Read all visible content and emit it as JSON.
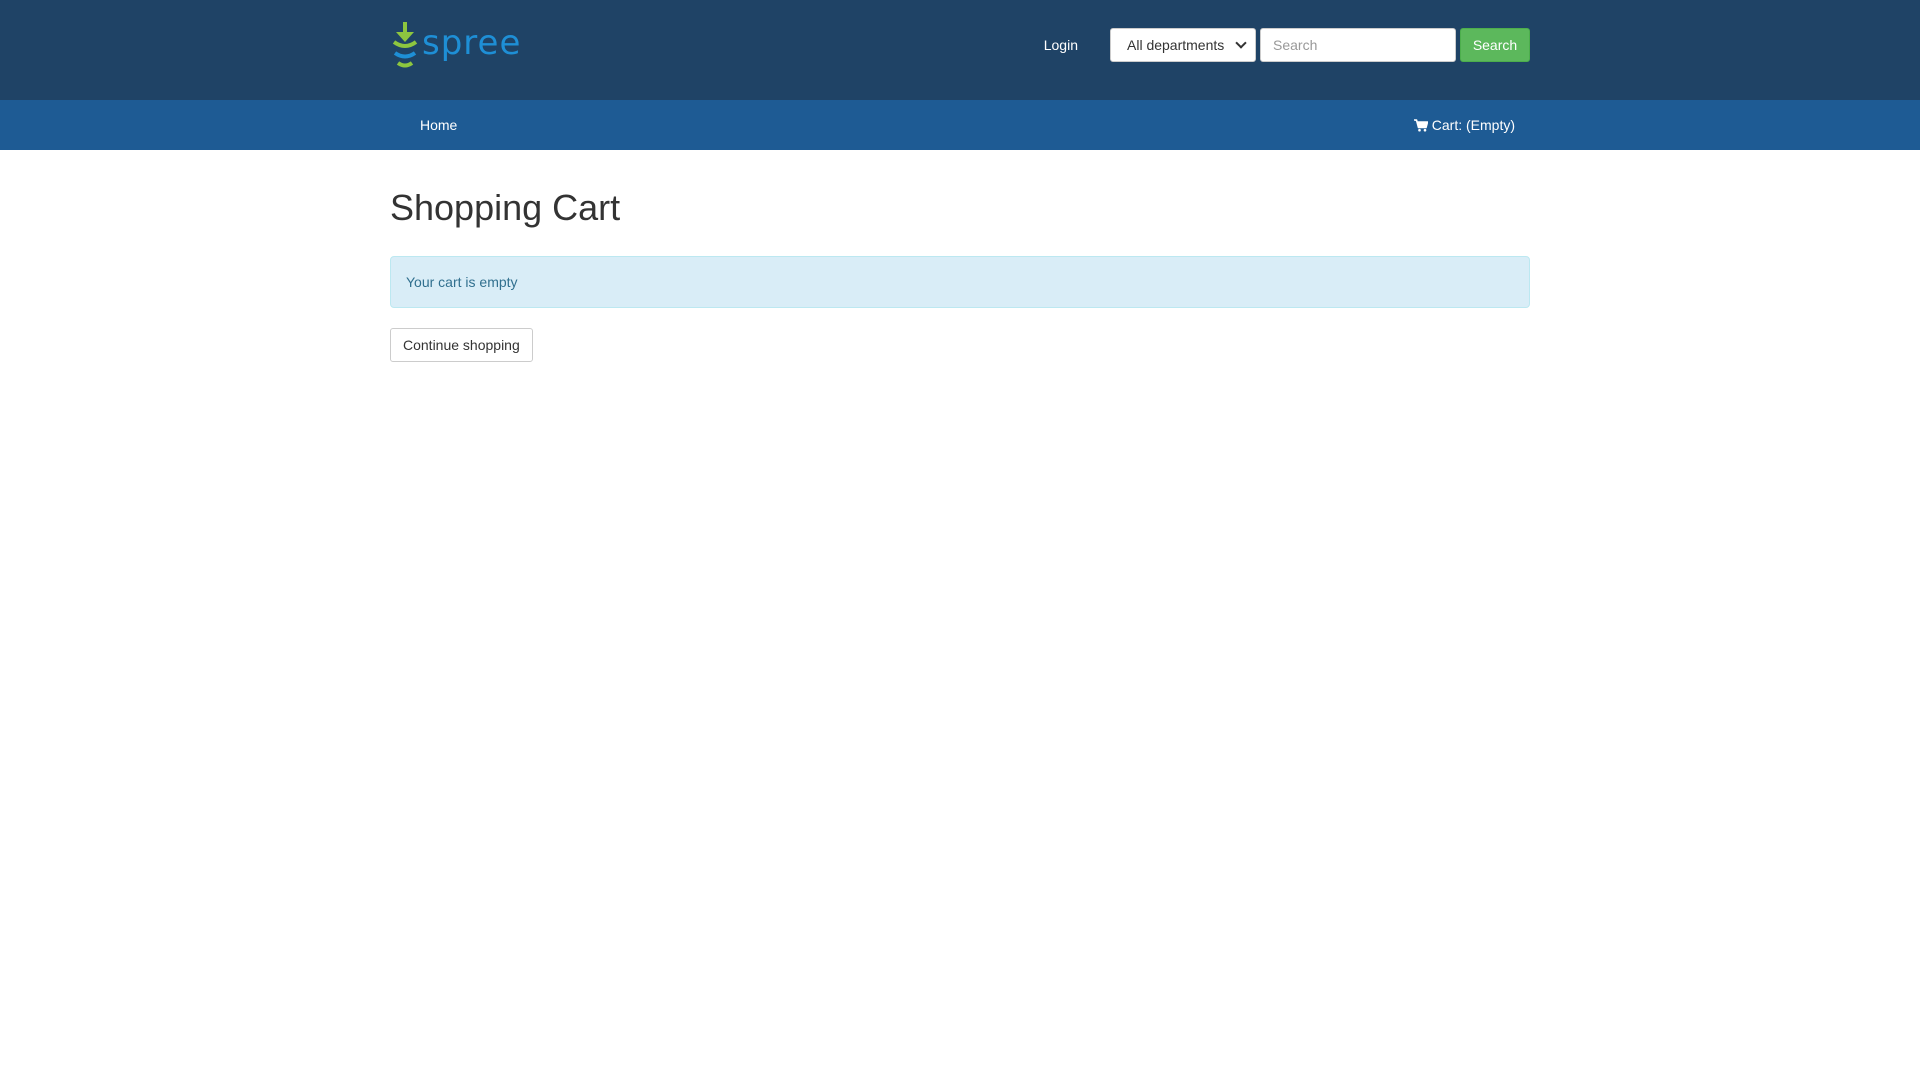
{
  "brand": {
    "name": "spree",
    "accent": "#1e8fd6",
    "icon_color": "#8dc63f"
  },
  "header": {
    "login_label": "Login",
    "department_select": {
      "selected": "All departments"
    },
    "search": {
      "placeholder": "Search",
      "button_label": "Search"
    },
    "background": "#1f4366"
  },
  "nav": {
    "home_label": "Home",
    "cart_label": "Cart: (Empty)",
    "cart_icon": "cart-icon",
    "background": "#1e5b94"
  },
  "main": {
    "title": "Shopping Cart",
    "empty_message": "Your cart is empty",
    "continue_label": "Continue shopping"
  }
}
